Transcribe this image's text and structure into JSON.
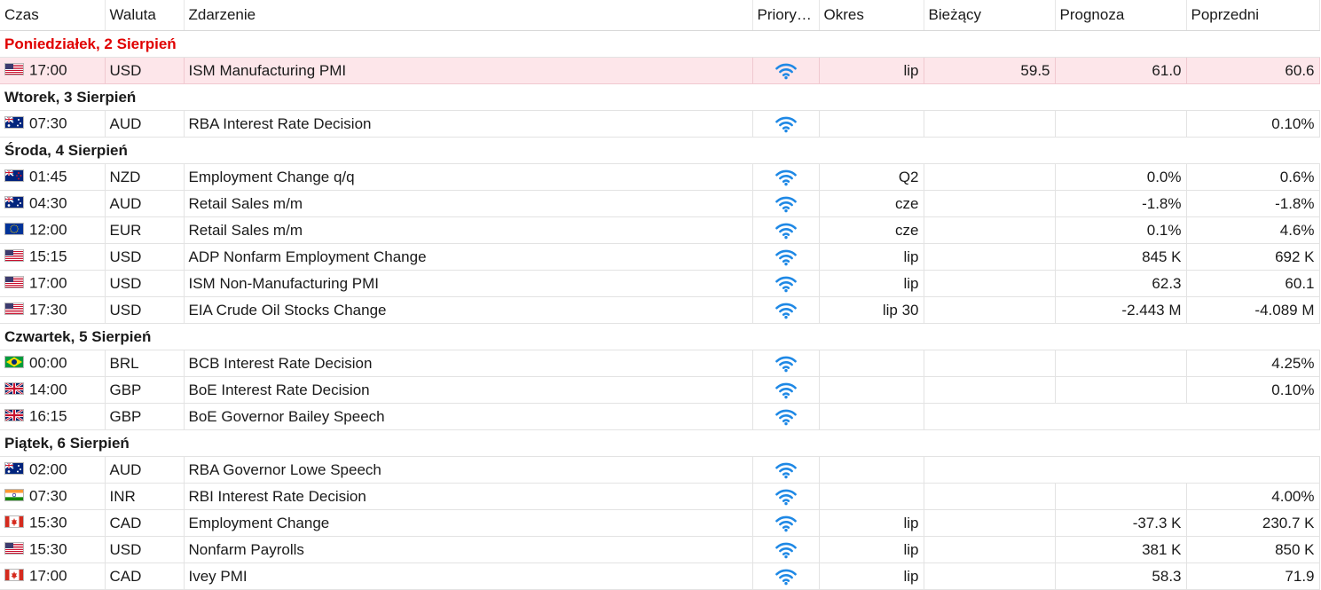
{
  "headers": {
    "time": "Czas",
    "currency": "Waluta",
    "event": "Zdarzenie",
    "priority": "Priory…",
    "period": "Okres",
    "actual": "Bieżący",
    "forecast": "Prognoza",
    "previous": "Poprzedni"
  },
  "days": [
    {
      "label": "Poniedziałek, 2 Sierpień",
      "today": true,
      "events": [
        {
          "flag": "us",
          "time": "17:00",
          "currency": "USD",
          "event": "ISM Manufacturing PMI",
          "period": "lip",
          "actual": "59.5",
          "forecast": "61.0",
          "previous": "60.6",
          "highlight": true
        }
      ]
    },
    {
      "label": "Wtorek, 3 Sierpień",
      "events": [
        {
          "flag": "au",
          "time": "07:30",
          "currency": "AUD",
          "event": "RBA Interest Rate Decision",
          "period": "",
          "actual": "",
          "forecast": "",
          "previous": "0.10%"
        }
      ]
    },
    {
      "label": "Środa, 4 Sierpień",
      "events": [
        {
          "flag": "nz",
          "time": "01:45",
          "currency": "NZD",
          "event": "Employment Change q/q",
          "period": "Q2",
          "actual": "",
          "forecast": "0.0%",
          "previous": "0.6%"
        },
        {
          "flag": "au",
          "time": "04:30",
          "currency": "AUD",
          "event": "Retail Sales m/m",
          "period": "cze",
          "actual": "",
          "forecast": "-1.8%",
          "previous": "-1.8%"
        },
        {
          "flag": "eu",
          "time": "12:00",
          "currency": "EUR",
          "event": "Retail Sales m/m",
          "period": "cze",
          "actual": "",
          "forecast": "0.1%",
          "previous": "4.6%"
        },
        {
          "flag": "us",
          "time": "15:15",
          "currency": "USD",
          "event": "ADP Nonfarm Employment Change",
          "period": "lip",
          "actual": "",
          "forecast": "845 K",
          "previous": "692 K"
        },
        {
          "flag": "us",
          "time": "17:00",
          "currency": "USD",
          "event": "ISM Non-Manufacturing PMI",
          "period": "lip",
          "actual": "",
          "forecast": "62.3",
          "previous": "60.1"
        },
        {
          "flag": "us",
          "time": "17:30",
          "currency": "USD",
          "event": "EIA Crude Oil Stocks Change",
          "period": "lip 30",
          "actual": "",
          "forecast": "-2.443 M",
          "previous": "-4.089 M"
        }
      ]
    },
    {
      "label": "Czwartek, 5 Sierpień",
      "events": [
        {
          "flag": "br",
          "time": "00:00",
          "currency": "BRL",
          "event": "BCB Interest Rate Decision",
          "period": "",
          "actual": "",
          "forecast": "",
          "previous": "4.25%"
        },
        {
          "flag": "gb",
          "time": "14:00",
          "currency": "GBP",
          "event": "BoE Interest Rate Decision",
          "period": "",
          "actual": "",
          "forecast": "",
          "previous": "0.10%"
        },
        {
          "flag": "gb",
          "time": "16:15",
          "currency": "GBP",
          "event": "BoE Governor Bailey Speech",
          "speech": true
        }
      ]
    },
    {
      "label": "Piątek, 6 Sierpień",
      "events": [
        {
          "flag": "au",
          "time": "02:00",
          "currency": "AUD",
          "event": "RBA Governor Lowe Speech",
          "speech": true
        },
        {
          "flag": "in",
          "time": "07:30",
          "currency": "INR",
          "event": "RBI Interest Rate Decision",
          "period": "",
          "actual": "",
          "forecast": "",
          "previous": "4.00%"
        },
        {
          "flag": "ca",
          "time": "15:30",
          "currency": "CAD",
          "event": "Employment Change",
          "period": "lip",
          "actual": "",
          "forecast": "-37.3 K",
          "previous": "230.7 K"
        },
        {
          "flag": "us",
          "time": "15:30",
          "currency": "USD",
          "event": "Nonfarm Payrolls",
          "period": "lip",
          "actual": "",
          "forecast": "381 K",
          "previous": "850 K"
        },
        {
          "flag": "ca",
          "time": "17:00",
          "currency": "CAD",
          "event": "Ivey PMI",
          "period": "lip",
          "actual": "",
          "forecast": "58.3",
          "previous": "71.9"
        }
      ]
    }
  ],
  "colors": {
    "today_label": "#e00000",
    "highlight_row": "#fde6ea",
    "priority_icon": "#1e88e5"
  },
  "icons": {
    "priority": "wifi-signal-icon",
    "flags": {
      "us": "us-flag-icon",
      "au": "australia-flag-icon",
      "nz": "new-zealand-flag-icon",
      "eu": "eu-flag-icon",
      "br": "brazil-flag-icon",
      "gb": "uk-flag-icon",
      "in": "india-flag-icon",
      "ca": "canada-flag-icon"
    }
  }
}
